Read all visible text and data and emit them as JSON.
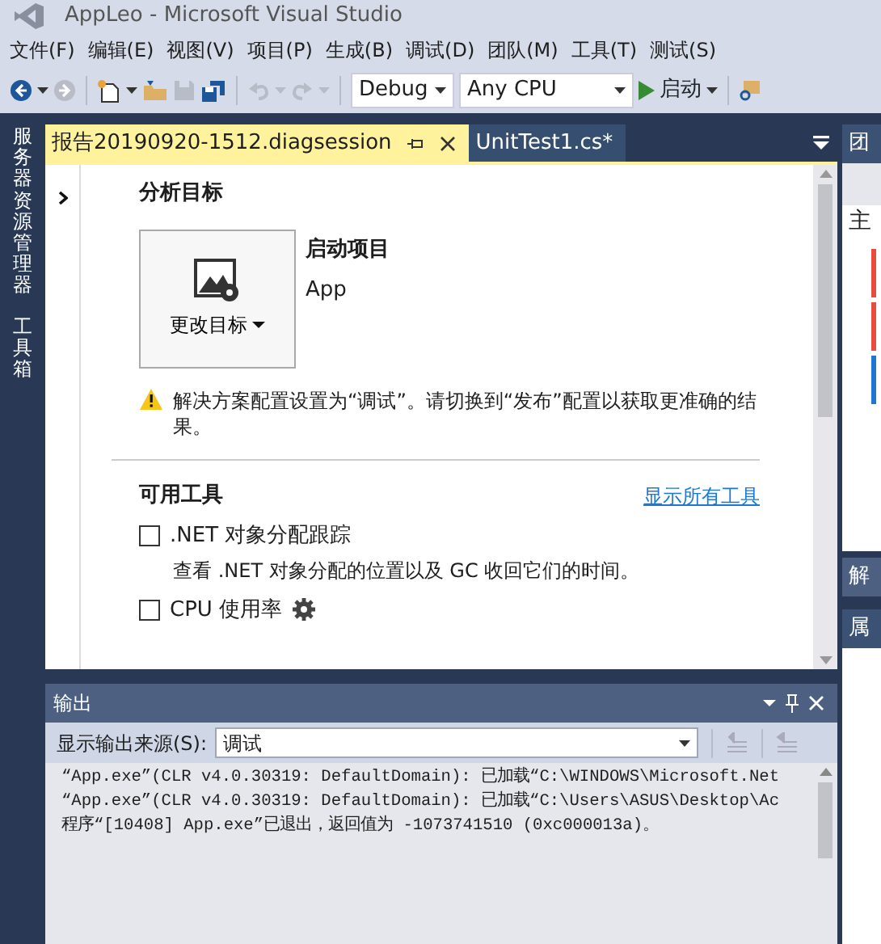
{
  "window": {
    "title": "AppLeo - Microsoft Visual Studio"
  },
  "menu": [
    "文件(F)",
    "编辑(E)",
    "视图(V)",
    "项目(P)",
    "生成(B)",
    "调试(D)",
    "团队(M)",
    "工具(T)",
    "测试(S)"
  ],
  "toolbar": {
    "configuration": "Debug",
    "platform": "Any CPU",
    "start_label": "启动"
  },
  "side_tabs": [
    "服务器资源管理器",
    "工具箱"
  ],
  "doc_tabs": [
    {
      "label": "报告20190920-1512.diagsession",
      "selected": true
    },
    {
      "label": "UnitTest1.cs*",
      "selected": false
    }
  ],
  "diag": {
    "target_heading": "分析目标",
    "change_target": "更改目标",
    "project_heading": "启动项目",
    "project_name": "App",
    "warning": "解决方案配置设置为“调试”。请切换到“发布”配置以获取更准确的结果。",
    "tools_heading": "可用工具",
    "show_all": "显示所有工具",
    "tools": [
      {
        "label": ".NET 对象分配跟踪",
        "checked": false,
        "settings": false,
        "description": "查看 .NET 对象分配的位置以及 GC 收回它们的时间。"
      },
      {
        "label": "CPU 使用率",
        "checked": false,
        "settings": true
      }
    ]
  },
  "output": {
    "title": "输出",
    "source_label": "显示输出来源(S):",
    "source": "调试",
    "lines": [
      "“App.exe”(CLR v4.0.30319: DefaultDomain): 已加载“C:\\WINDOWS\\Microsoft.Net",
      "“App.exe”(CLR v4.0.30319: DefaultDomain): 已加载“C:\\Users\\ASUS\\Desktop\\Ac",
      "程序“[10408] App.exe”已退出，返回值为 -1073741510 (0xc000013a)。"
    ]
  },
  "right_panel": {
    "title": "团",
    "heading": "主",
    "tab": "解",
    "properties_title": "属"
  }
}
